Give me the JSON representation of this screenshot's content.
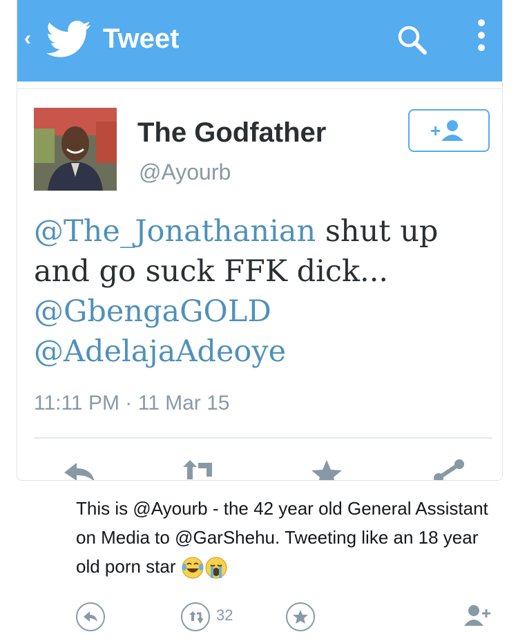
{
  "screenshot": {
    "app_bar": {
      "back_glyph": "‹",
      "title": "Tweet",
      "color": "#55acee"
    },
    "tweet": {
      "name": "The Godfather",
      "handle": "@Ayourb",
      "text": {
        "mention1": "@The_Jonathanian",
        "body1": " shut up and go suck FFK dick...",
        "mention2": "@GbengaGOLD",
        "mention3": "@AdelajaAdeoye"
      },
      "timestamp": "11:11 PM · 11 Mar 15",
      "actions": [
        "reply-icon",
        "retweet-icon",
        "favorite-icon",
        "share-icon"
      ]
    }
  },
  "caption": {
    "text": "This is @Ayourb - the 42 year old General Assistant on Media to @GarShehu. Tweeting like an 18 year old porn star",
    "emojis": [
      "face-with-tears-of-joy",
      "loudly-crying-face"
    ]
  },
  "bottom_actions": {
    "retweet_count": "32",
    "icons": [
      "reply-icon",
      "retweet-icon",
      "favorite-icon",
      "follow-icon"
    ]
  },
  "colors": {
    "twitter_blue": "#55acee",
    "mention": "#4f91ba",
    "muted": "#8899a6"
  }
}
